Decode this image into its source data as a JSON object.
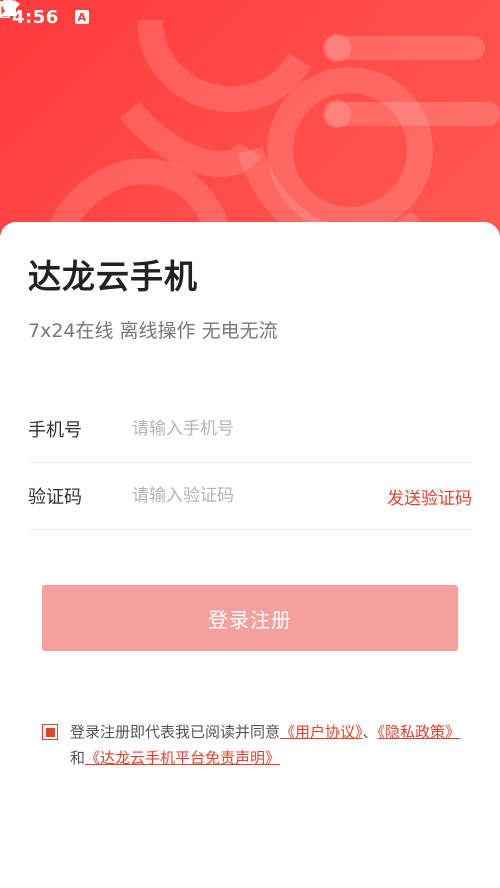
{
  "status": {
    "time": "4:56",
    "notify_icon_letter": "A"
  },
  "app": {
    "title": "达龙云手机",
    "subtitle": "7x24在线 离线操作 无电无流"
  },
  "form": {
    "phone_label": "手机号",
    "phone_placeholder": "请输入手机号",
    "phone_value": "",
    "code_label": "验证码",
    "code_placeholder": "请输入验证码",
    "code_value": "",
    "send_code_label": "发送验证码"
  },
  "login": {
    "label": "登录注册"
  },
  "agreement": {
    "checked": true,
    "prefix": "登录注册即代表我已阅读并同意",
    "link_user": "《用户协议》",
    "separator": "、",
    "link_privacy": "《隐私政策》",
    "and": "和",
    "link_disclaimer": "《达龙云手机平台免责声明》"
  },
  "colors": {
    "brand": "#ff3a3a",
    "accent": "#e8422e",
    "button_disabled": "#f5a09f"
  }
}
